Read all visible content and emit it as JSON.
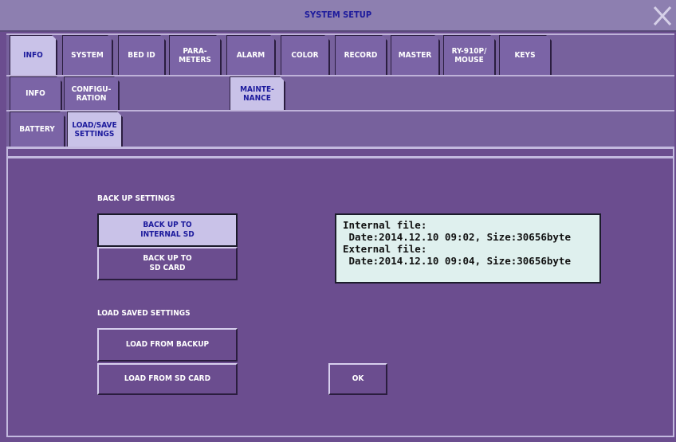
{
  "window": {
    "title": "SYSTEM SETUP"
  },
  "main_tabs": [
    {
      "label": "INFO",
      "active": true
    },
    {
      "label": "SYSTEM"
    },
    {
      "label": "BED ID"
    },
    {
      "label": "PARA-\nMETERS"
    },
    {
      "label": "ALARM"
    },
    {
      "label": "COLOR"
    },
    {
      "label": "RECORD"
    },
    {
      "label": "MASTER"
    },
    {
      "label": "RY-910P/\nMOUSE"
    },
    {
      "label": "KEYS"
    }
  ],
  "sub_tabs": [
    {
      "label": "INFO"
    },
    {
      "label": "CONFIGU-\nRATION"
    },
    {
      "label": "MAINTE-\nNANCE",
      "active": true
    }
  ],
  "sub_sub_tabs": [
    {
      "label": "BATTERY"
    },
    {
      "label": "LOAD/SAVE\nSETTINGS",
      "active": true
    }
  ],
  "backup": {
    "heading": "BACK UP SETTINGS",
    "internal_label": "BACK UP TO\nINTERNAL SD",
    "sd_label": "BACK UP TO\nSD CARD"
  },
  "load": {
    "heading": "LOAD SAVED SETTINGS",
    "from_backup_label": "LOAD FROM BACKUP",
    "from_sd_label": "LOAD FROM SD CARD"
  },
  "file_info": {
    "internal_title": "Internal file:",
    "internal_detail": " Date:2014.12.10 09:02, Size:30656byte",
    "external_title": "External file:",
    "external_detail": " Date:2014.12.10 09:04, Size:30656byte"
  },
  "ok_label": "OK",
  "colors": {
    "background": "#6b4d8f",
    "title_bar": "#8d7fb0",
    "active_tab": "#c9c2e8",
    "title_text": "#1c1a9c",
    "info_box": "#dff0ee"
  },
  "icons": {
    "close": "close-x-icon"
  }
}
